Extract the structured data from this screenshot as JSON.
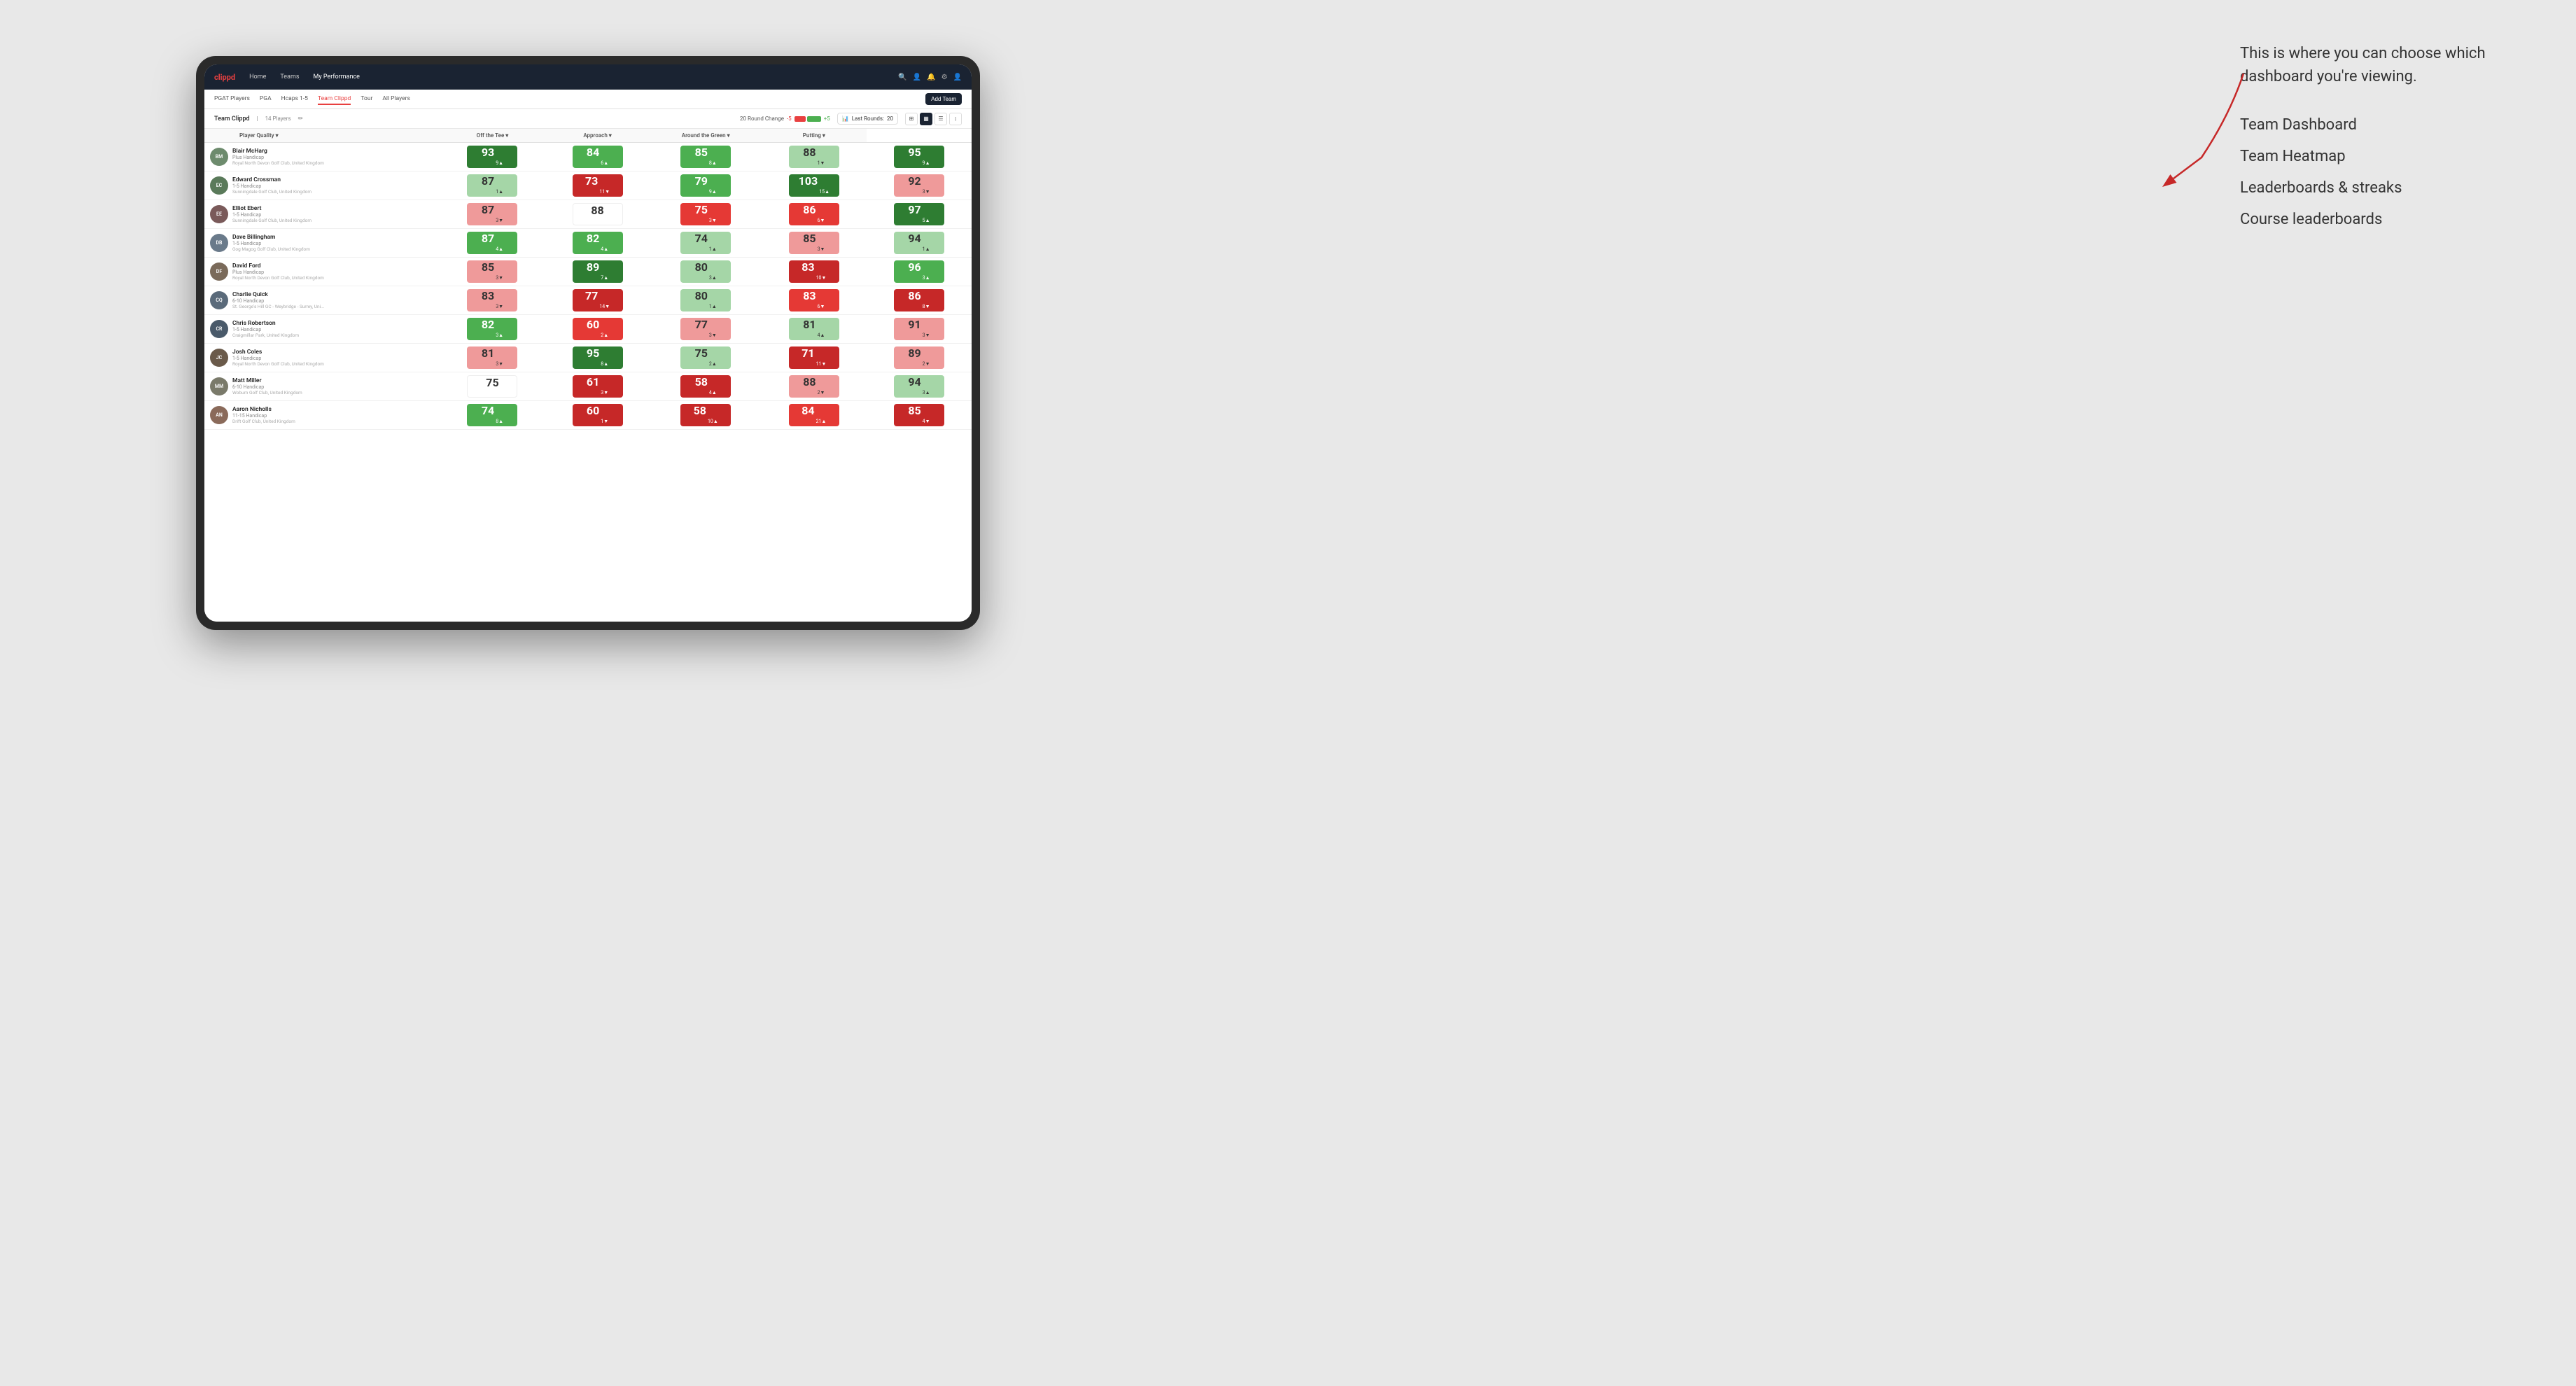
{
  "annotation": {
    "intro": "This is where you can choose which dashboard you're viewing.",
    "items": [
      "Team Dashboard",
      "Team Heatmap",
      "Leaderboards & streaks",
      "Course leaderboards"
    ]
  },
  "nav": {
    "logo": "clippd",
    "links": [
      "Home",
      "Teams",
      "My Performance"
    ],
    "active": "My Performance"
  },
  "subnav": {
    "links": [
      "PGAT Players",
      "PGA",
      "Hcaps 1-5",
      "Team Clippd",
      "Tour",
      "All Players"
    ],
    "active": "Team Clippd",
    "add_team": "Add Team"
  },
  "team_header": {
    "name": "Team Clippd",
    "separator": "|",
    "count": "14 Players",
    "round_change_label": "20 Round Change",
    "change_minus": "-5",
    "change_plus": "+5",
    "last_rounds_label": "Last Rounds:",
    "last_rounds_value": "20"
  },
  "table": {
    "columns": [
      {
        "id": "player",
        "label": "Player Quality ▾"
      },
      {
        "id": "off_tee",
        "label": "Off the Tee ▾"
      },
      {
        "id": "approach",
        "label": "Approach ▾"
      },
      {
        "id": "around_green",
        "label": "Around the Green ▾"
      },
      {
        "id": "putting",
        "label": "Putting ▾"
      }
    ],
    "rows": [
      {
        "name": "Blair McHarg",
        "handicap": "Plus Handicap",
        "club": "Royal North Devon Golf Club, United Kingdom",
        "initials": "BM",
        "avatar_color": "#6d8b6d",
        "scores": [
          {
            "value": "93",
            "change": "9▲",
            "color": "green-dark"
          },
          {
            "value": "84",
            "change": "6▲",
            "color": "green-mid"
          },
          {
            "value": "85",
            "change": "8▲",
            "color": "green-mid"
          },
          {
            "value": "88",
            "change": "1▼",
            "color": "green-light"
          },
          {
            "value": "95",
            "change": "9▲",
            "color": "green-dark"
          }
        ]
      },
      {
        "name": "Edward Crossman",
        "handicap": "1-5 Handicap",
        "club": "Sunningdale Golf Club, United Kingdom",
        "initials": "EC",
        "avatar_color": "#5a7a5a",
        "scores": [
          {
            "value": "87",
            "change": "1▲",
            "color": "green-light"
          },
          {
            "value": "73",
            "change": "11▼",
            "color": "red-dark"
          },
          {
            "value": "79",
            "change": "9▲",
            "color": "green-mid"
          },
          {
            "value": "103",
            "change": "15▲",
            "color": "green-dark"
          },
          {
            "value": "92",
            "change": "3▼",
            "color": "red-light"
          }
        ]
      },
      {
        "name": "Elliot Ebert",
        "handicap": "1-5 Handicap",
        "club": "Sunningdale Golf Club, United Kingdom",
        "initials": "EE",
        "avatar_color": "#7a5a5a",
        "scores": [
          {
            "value": "87",
            "change": "3▼",
            "color": "red-light"
          },
          {
            "value": "88",
            "change": "",
            "color": "white-cell"
          },
          {
            "value": "75",
            "change": "3▼",
            "color": "red-mid"
          },
          {
            "value": "86",
            "change": "6▼",
            "color": "red-mid"
          },
          {
            "value": "97",
            "change": "5▲",
            "color": "green-dark"
          }
        ]
      },
      {
        "name": "Dave Billingham",
        "handicap": "1-5 Handicap",
        "club": "Gog Magog Golf Club, United Kingdom",
        "initials": "DB",
        "avatar_color": "#6a7a8a",
        "scores": [
          {
            "value": "87",
            "change": "4▲",
            "color": "green-mid"
          },
          {
            "value": "82",
            "change": "4▲",
            "color": "green-mid"
          },
          {
            "value": "74",
            "change": "1▲",
            "color": "green-light"
          },
          {
            "value": "85",
            "change": "3▼",
            "color": "red-light"
          },
          {
            "value": "94",
            "change": "1▲",
            "color": "green-light"
          }
        ]
      },
      {
        "name": "David Ford",
        "handicap": "Plus Handicap",
        "club": "Royal North Devon Golf Club, United Kingdom",
        "initials": "DF",
        "avatar_color": "#7a6a5a",
        "scores": [
          {
            "value": "85",
            "change": "3▼",
            "color": "red-light"
          },
          {
            "value": "89",
            "change": "7▲",
            "color": "green-dark"
          },
          {
            "value": "80",
            "change": "3▲",
            "color": "green-light"
          },
          {
            "value": "83",
            "change": "10▼",
            "color": "red-dark"
          },
          {
            "value": "96",
            "change": "3▲",
            "color": "green-mid"
          }
        ]
      },
      {
        "name": "Charlie Quick",
        "handicap": "6-10 Handicap",
        "club": "St. George's Hill GC - Weybridge - Surrey, Uni...",
        "initials": "CQ",
        "avatar_color": "#5a6a7a",
        "scores": [
          {
            "value": "83",
            "change": "3▼",
            "color": "red-light"
          },
          {
            "value": "77",
            "change": "14▼",
            "color": "red-dark"
          },
          {
            "value": "80",
            "change": "1▲",
            "color": "green-light"
          },
          {
            "value": "83",
            "change": "6▼",
            "color": "red-mid"
          },
          {
            "value": "86",
            "change": "8▼",
            "color": "red-dark"
          }
        ]
      },
      {
        "name": "Chris Robertson",
        "handicap": "1-5 Handicap",
        "club": "Craigmillar Park, United Kingdom",
        "initials": "CR",
        "avatar_color": "#4a5a6a",
        "scores": [
          {
            "value": "82",
            "change": "3▲",
            "color": "green-mid"
          },
          {
            "value": "60",
            "change": "2▲",
            "color": "red-mid"
          },
          {
            "value": "77",
            "change": "3▼",
            "color": "red-light"
          },
          {
            "value": "81",
            "change": "4▲",
            "color": "green-light"
          },
          {
            "value": "91",
            "change": "3▼",
            "color": "red-light"
          }
        ]
      },
      {
        "name": "Josh Coles",
        "handicap": "1-5 Handicap",
        "club": "Royal North Devon Golf Club, United Kingdom",
        "initials": "JC",
        "avatar_color": "#6a5a4a",
        "scores": [
          {
            "value": "81",
            "change": "3▼",
            "color": "red-light"
          },
          {
            "value": "95",
            "change": "8▲",
            "color": "green-dark"
          },
          {
            "value": "75",
            "change": "2▲",
            "color": "green-light"
          },
          {
            "value": "71",
            "change": "11▼",
            "color": "red-dark"
          },
          {
            "value": "89",
            "change": "2▼",
            "color": "red-light"
          }
        ]
      },
      {
        "name": "Matt Miller",
        "handicap": "6-10 Handicap",
        "club": "Woburn Golf Club, United Kingdom",
        "initials": "MM",
        "avatar_color": "#7a7a6a",
        "scores": [
          {
            "value": "75",
            "change": "",
            "color": "white-cell"
          },
          {
            "value": "61",
            "change": "3▼",
            "color": "red-dark"
          },
          {
            "value": "58",
            "change": "4▲",
            "color": "red-dark"
          },
          {
            "value": "88",
            "change": "2▼",
            "color": "red-light"
          },
          {
            "value": "94",
            "change": "3▲",
            "color": "green-light"
          }
        ]
      },
      {
        "name": "Aaron Nicholls",
        "handicap": "11-15 Handicap",
        "club": "Drift Golf Club, United Kingdom",
        "initials": "AN",
        "avatar_color": "#8a6a5a",
        "scores": [
          {
            "value": "74",
            "change": "8▲",
            "color": "green-mid"
          },
          {
            "value": "60",
            "change": "1▼",
            "color": "red-dark"
          },
          {
            "value": "58",
            "change": "10▲",
            "color": "red-dark"
          },
          {
            "value": "84",
            "change": "21▲",
            "color": "red-mid"
          },
          {
            "value": "85",
            "change": "4▼",
            "color": "red-dark"
          }
        ]
      }
    ]
  }
}
